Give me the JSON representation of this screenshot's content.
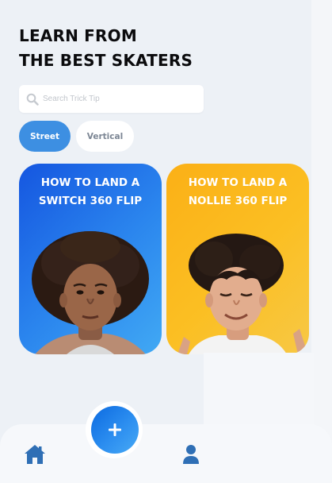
{
  "header": {
    "title_line1": "LEARN FROM",
    "title_line2": "THE BEST SKATERS"
  },
  "search": {
    "icon": "search-icon",
    "placeholder": "Search Trick Tip",
    "value": ""
  },
  "filters": [
    {
      "label": "Street",
      "selected": true
    },
    {
      "label": "Vertical",
      "selected": false
    }
  ],
  "cards": [
    {
      "title": "HOW TO LAND A SWITCH 360 FLIP",
      "accent": "#1e6ee8"
    },
    {
      "title": "HOW TO LAND A NOLLIE 360 FLIP",
      "accent": "#fbb61c"
    }
  ],
  "nav": {
    "home_icon": "home-icon",
    "add_icon": "plus-icon",
    "profile_icon": "user-icon"
  },
  "colors": {
    "accent": "#3d8fe2",
    "background": "#edf1f6",
    "nav_icon": "#2f6fb5"
  }
}
